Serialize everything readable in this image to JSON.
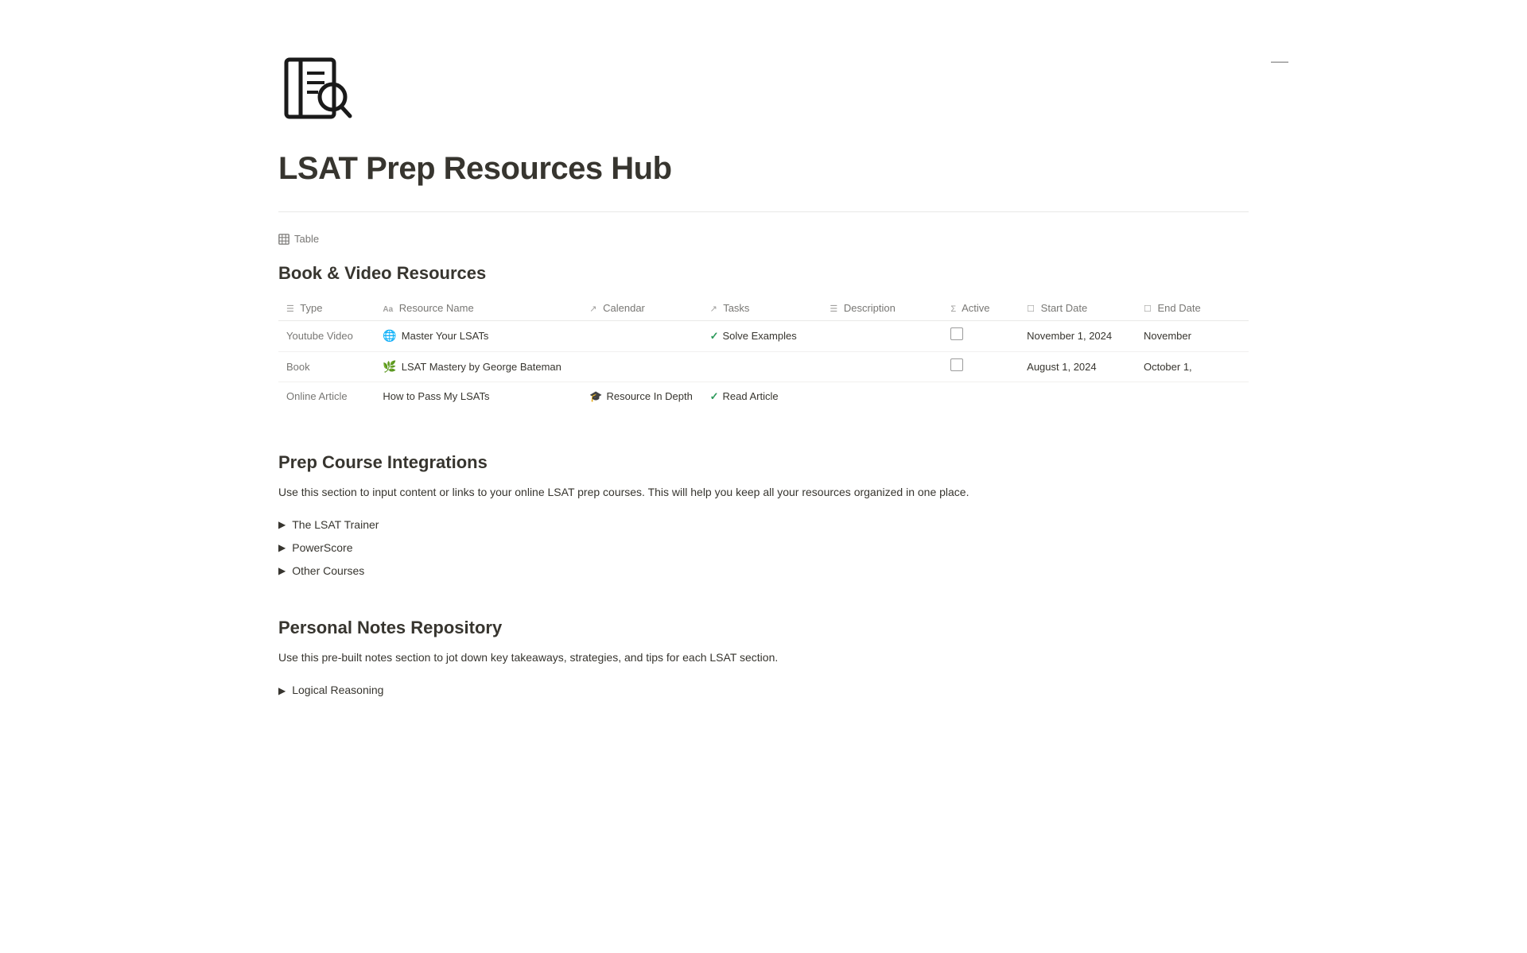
{
  "page": {
    "title": "LSAT Prep Resources Hub",
    "minimize_btn": "—"
  },
  "table_view": {
    "label": "Table"
  },
  "table": {
    "heading": "Book & Video Resources",
    "columns": [
      {
        "id": "type",
        "icon": "list-icon",
        "label": "Type"
      },
      {
        "id": "name",
        "icon": "aa-icon",
        "label": "Resource Name"
      },
      {
        "id": "calendar",
        "icon": "arrow-icon",
        "label": "Calendar"
      },
      {
        "id": "tasks",
        "icon": "arrow-icon",
        "label": "Tasks"
      },
      {
        "id": "description",
        "icon": "list-icon",
        "label": "Description"
      },
      {
        "id": "active",
        "icon": "sum-icon",
        "label": "Active"
      },
      {
        "id": "start_date",
        "icon": "calendar-icon",
        "label": "Start Date"
      },
      {
        "id": "end_date",
        "icon": "calendar-icon",
        "label": "End Date"
      }
    ],
    "rows": [
      {
        "type": "Youtube Video",
        "name": "Master Your LSATs",
        "name_emoji": "🌐",
        "calendar": "",
        "tasks": "Solve Examples",
        "description": "",
        "active": "checkbox",
        "start_date": "November 1, 2024",
        "end_date": "November"
      },
      {
        "type": "Book",
        "name": "LSAT Mastery by George Bateman",
        "name_emoji": "🌿",
        "calendar": "",
        "tasks": "",
        "description": "",
        "active": "checkbox",
        "start_date": "August 1, 2024",
        "end_date": "October 1,"
      },
      {
        "type": "Online Article",
        "name": "How to Pass My LSATs",
        "name_emoji": "",
        "calendar": "Resource In Depth",
        "calendar_emoji": "🎓",
        "tasks": "Read Article",
        "description": "",
        "active": "",
        "start_date": "",
        "end_date": ""
      }
    ]
  },
  "prep_course": {
    "heading": "Prep Course Integrations",
    "description": "Use this section to input content or links to your online LSAT prep courses. This will help you keep all your resources organized in one place.",
    "items": [
      {
        "label": "The LSAT Trainer"
      },
      {
        "label": "PowerScore"
      },
      {
        "label": "Other Courses"
      }
    ]
  },
  "personal_notes": {
    "heading": "Personal Notes Repository",
    "description": "Use this pre-built notes section to jot down key takeaways, strategies, and tips for each LSAT section.",
    "items": [
      {
        "label": "Logical Reasoning"
      }
    ]
  }
}
